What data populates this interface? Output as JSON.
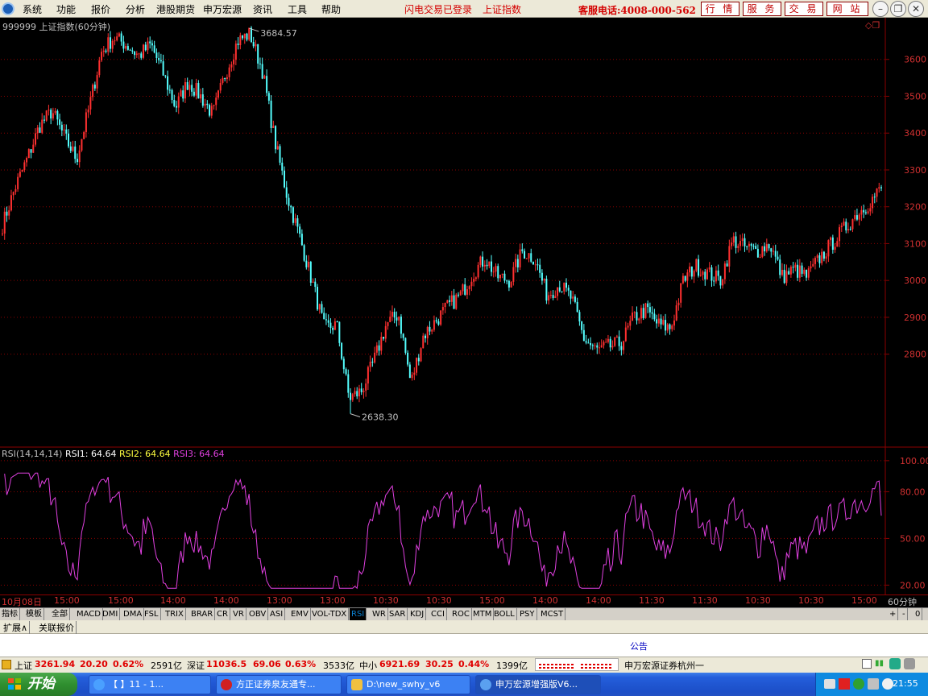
{
  "menu": {
    "items": [
      "系统",
      "功能",
      "报价",
      "分析",
      "港股期货",
      "申万宏源",
      "资讯",
      "工具",
      "帮助"
    ],
    "status_login": "闪电交易已登录",
    "current_index": "上证指数",
    "hotline": "客服电话:4008-000-562",
    "buttons": [
      "行 情",
      "服 务",
      "交 易",
      "网 站"
    ]
  },
  "chart": {
    "title": "999999 上证指数(60分钟)",
    "high_label": "3684.57",
    "low_label": "2638.30",
    "price_ticks": [
      "3600",
      "3500",
      "3400",
      "3300",
      "3200",
      "3100",
      "3000",
      "2900",
      "2800"
    ],
    "rsi_ticks": [
      "100.00",
      "80.00",
      "50.00",
      "20.00"
    ],
    "rsi_title": "RSI(14,14,14)",
    "rsi1_label": "RSI1:",
    "rsi1": "64.64",
    "rsi2_label": "RSI2:",
    "rsi2": "64.64",
    "rsi3_label": "RSI3:",
    "rsi3": "64.64",
    "colors": {
      "up": "#ff3030",
      "down": "#54ffff",
      "rsi": "#e040e0",
      "grid": "#8b0000"
    }
  },
  "chart_data": {
    "type": "candlestick",
    "period": "60分钟",
    "symbol": "999999",
    "name": "上证指数",
    "close_path": [
      3150,
      3250,
      3330,
      3420,
      3460,
      3390,
      3330,
      3470,
      3620,
      3660,
      3640,
      3610,
      3640,
      3560,
      3470,
      3540,
      3500,
      3450,
      3560,
      3650,
      3670,
      3570,
      3380,
      3230,
      3120,
      3000,
      2870,
      2880,
      2680,
      2700,
      2780,
      2880,
      2910,
      2720,
      2850,
      2890,
      2930,
      2960,
      3020,
      3060,
      3010,
      3000,
      3080,
      3060,
      2960,
      2990,
      2950,
      2840,
      2810,
      2820,
      2830,
      2900,
      2920,
      2880,
      2870,
      3000,
      3040,
      3020,
      3000,
      3110,
      3090,
      3080,
      3100,
      3010,
      3030,
      3010,
      3060,
      3100,
      3140,
      3180,
      3210,
      3250
    ],
    "high": 3684.57,
    "low": 2638.3,
    "ylim": [
      2550,
      3700
    ],
    "rsi_ylim": [
      15,
      102
    ],
    "rsi_last": 64.64,
    "x_labels": [
      "10月08日",
      "15:00",
      "15:00",
      "14:00",
      "14:00",
      "13:00",
      "13:00",
      "10:30",
      "10:30",
      "15:00",
      "14:00",
      "14:00",
      "11:30",
      "11:30",
      "10:30",
      "10:30",
      "15:00"
    ]
  },
  "time_axis": {
    "labels": [
      "10月08日",
      "15:00",
      "15:00",
      "14:00",
      "14:00",
      "13:00",
      "13:00",
      "10:30",
      "10:30",
      "15:00",
      "14:00",
      "14:00",
      "11:30",
      "11:30",
      "10:30",
      "10:30",
      "15:00"
    ],
    "period": "60分钟"
  },
  "tabs": {
    "items": [
      "指标",
      "模板",
      "全部",
      "MACD",
      "DMI",
      "DMA",
      "FSL",
      "TRIX",
      "BRAR",
      "CR",
      "VR",
      "OBV",
      "ASI",
      "EMV",
      "VOL-TDX",
      "RSI",
      "WR",
      "SAR",
      "KDJ",
      "CCI",
      "ROC",
      "MTM",
      "BOLL",
      "PSY",
      "MCST"
    ],
    "active": "RSI",
    "controls": [
      "+",
      "-",
      "0"
    ]
  },
  "subtabs": [
    "扩展∧",
    "关联报价"
  ],
  "announcement": "公告",
  "status": {
    "sh_label": "上证",
    "sh_value": "3261.94",
    "sh_change": "20.20",
    "sh_pct": "0.62%",
    "sh_amount": "2591亿",
    "sz_label": "深证",
    "sz_value": "11036.5",
    "sz_change": "69.06",
    "sz_pct": "0.63%",
    "sz_amount": "3533亿",
    "sme_label": "中小",
    "sme_value": "6921.69",
    "sme_change": "30.25",
    "sme_pct": "0.44%",
    "sme_amount": "1399亿",
    "broker": "申万宏源证券杭州一"
  },
  "taskbar": {
    "start": "开始",
    "tasks": [
      "【 】11 - 1...",
      "方正证券泉友通专...",
      "D:\\new_swhy_v6",
      "申万宏源增强版V6..."
    ],
    "clock": "21:55"
  }
}
